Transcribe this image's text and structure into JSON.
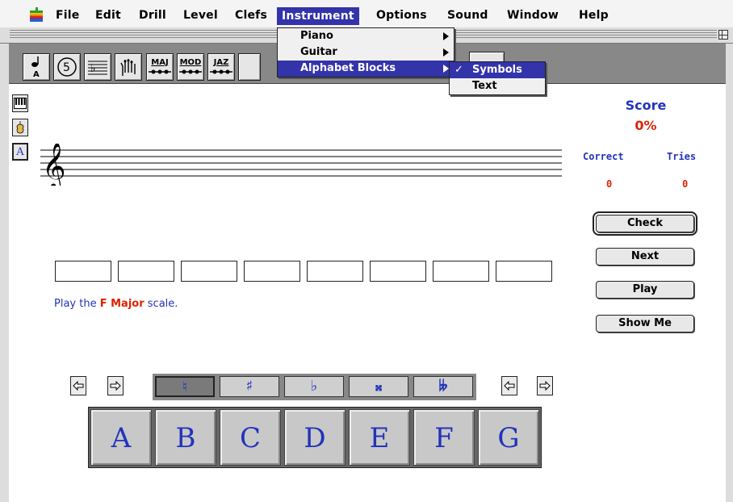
{
  "menubar": {
    "items": [
      {
        "label": "File"
      },
      {
        "label": "Edit"
      },
      {
        "label": "Drill"
      },
      {
        "label": "Level"
      },
      {
        "label": "Clefs"
      },
      {
        "label": "Instrument"
      },
      {
        "label": "Options"
      },
      {
        "label": "Sound"
      },
      {
        "label": "Window"
      },
      {
        "label": "Help"
      }
    ],
    "active": "Instrument"
  },
  "instrument_menu": {
    "items": [
      {
        "label": "Piano",
        "submenu": true
      },
      {
        "label": "Guitar",
        "submenu": true
      },
      {
        "label": "Alphabet Blocks",
        "submenu": true,
        "highlighted": true
      }
    ]
  },
  "alphabet_submenu": {
    "items": [
      {
        "label": "Symbols",
        "checked": true,
        "check": "✓"
      },
      {
        "label": "Text",
        "checked": false
      }
    ]
  },
  "toolbar": {
    "buttons": [
      {
        "icon": "note-a-icon",
        "text": "A"
      },
      {
        "icon": "circle-5-icon",
        "text": "5"
      },
      {
        "icon": "staff-icon"
      },
      {
        "icon": "hand-icon"
      },
      {
        "label": "MAJ"
      },
      {
        "label": "MOD"
      },
      {
        "label": "JAZ"
      }
    ]
  },
  "sidebar": {
    "icons": [
      "piano-icon",
      "violin-icon",
      "alphabet-icon"
    ],
    "alphabet_letter": "A"
  },
  "score": {
    "title": "Score",
    "percent": "0%",
    "correct_label": "Correct",
    "tries_label": "Tries",
    "correct_value": "0",
    "tries_value": "0"
  },
  "buttons": {
    "check": "Check",
    "next": "Next",
    "play": "Play",
    "show_me": "Show Me"
  },
  "prompt": {
    "prefix": "Play the ",
    "key": "F Major",
    "suffix": " scale."
  },
  "answer_slots": 8,
  "accidentals": [
    {
      "symbol": "♮",
      "selected": true
    },
    {
      "symbol": "♯"
    },
    {
      "symbol": "♭"
    },
    {
      "symbol": "𝄪"
    },
    {
      "symbol": "𝄫"
    }
  ],
  "letters": [
    "A",
    "B",
    "C",
    "D",
    "E",
    "F",
    "G"
  ],
  "colors": {
    "accent_blue": "#2233bb",
    "accent_red": "#dd2200",
    "menu_highlight": "#3333aa"
  }
}
